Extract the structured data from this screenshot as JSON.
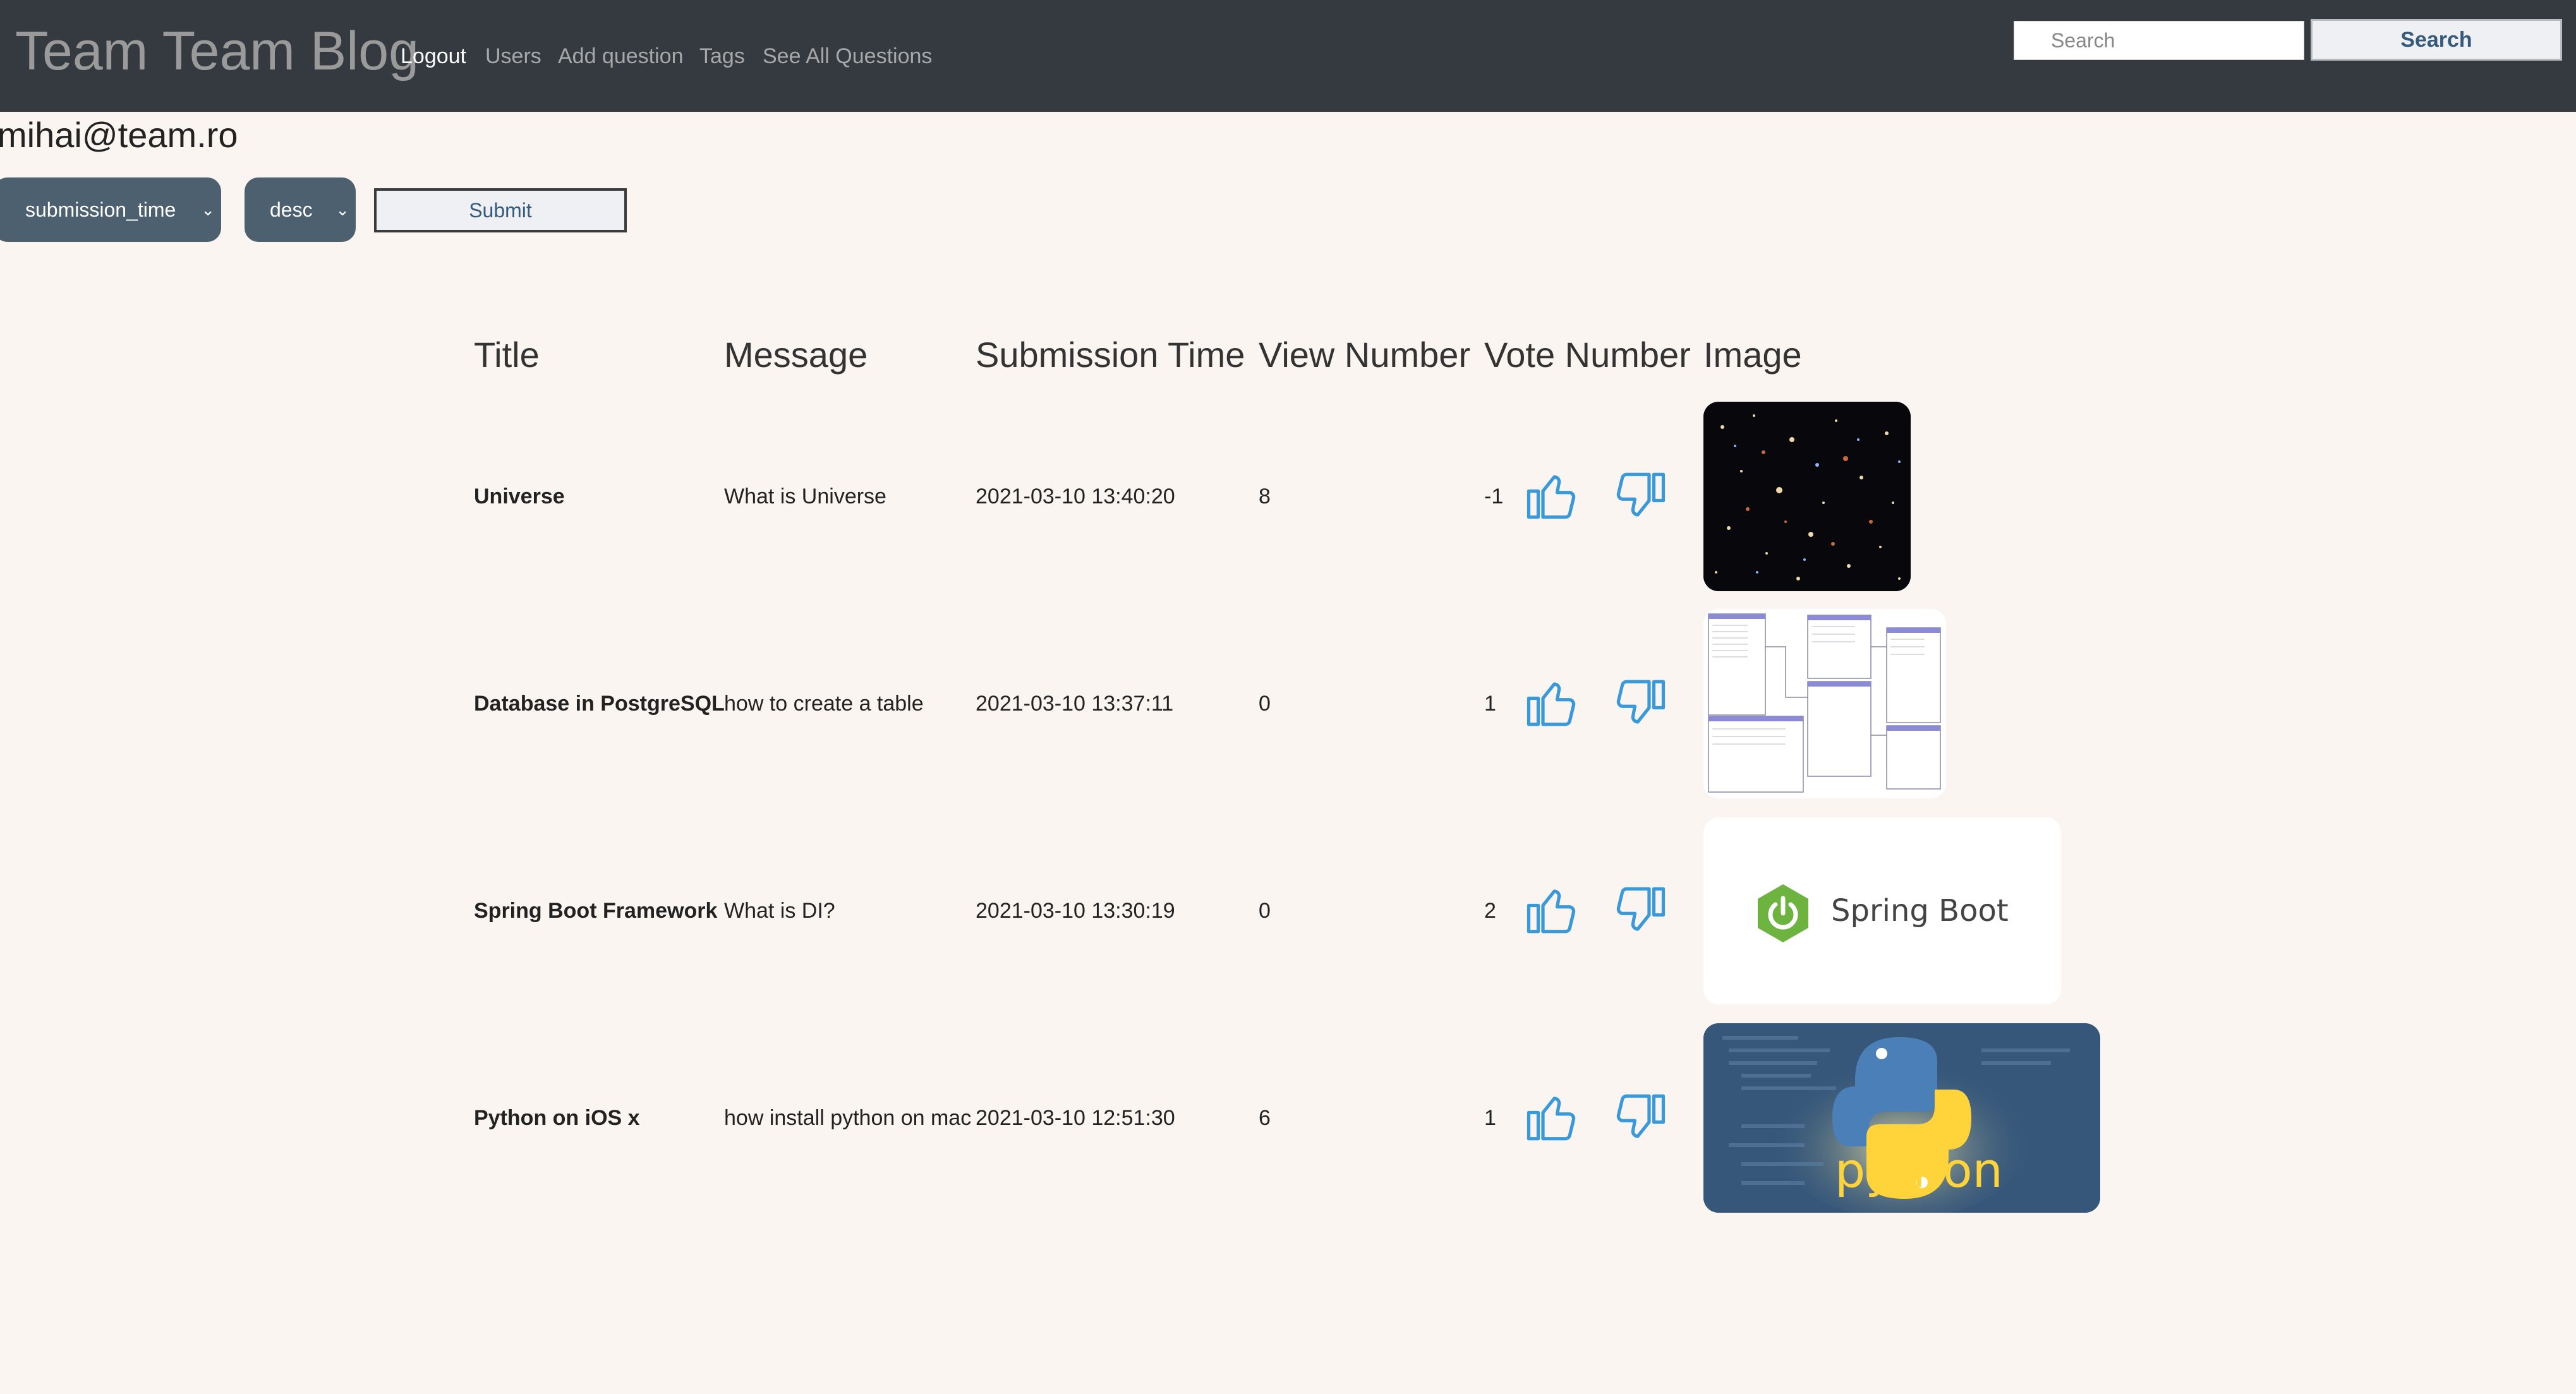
{
  "navbar": {
    "brand": "Team Team Blog",
    "links": [
      "Logout",
      "Users",
      "Add question",
      "Tags",
      "See All Questions"
    ],
    "search_placeholder": "Search",
    "search_button": "Search"
  },
  "user": {
    "email": "mihai@team.ro"
  },
  "sort_controls": {
    "sort_by": "submission_time",
    "order": "desc",
    "submit": "Submit"
  },
  "table": {
    "headers": [
      "Title",
      "Message",
      "Submission Time",
      "View Number",
      "Vote Number",
      "Image"
    ],
    "rows": [
      {
        "title": "Universe",
        "message": "What is Universe",
        "submission_time": "2021-03-10 13:40:20",
        "views": "8",
        "votes": "-1",
        "image": "galaxy-field-image"
      },
      {
        "title": "Database in PostgreSQL",
        "message": "how to create a table",
        "submission_time": "2021-03-10 13:37:11",
        "views": "0",
        "votes": "1",
        "image": "database-schema-image"
      },
      {
        "title": "Spring Boot Framework",
        "message": "What is DI?",
        "submission_time": "2021-03-10 13:30:19",
        "views": "0",
        "votes": "2",
        "image": "spring-boot-logo-image"
      },
      {
        "title": "Python on iOS x",
        "message": "how install python on mac",
        "submission_time": "2021-03-10 12:51:30",
        "views": "6",
        "votes": "1",
        "image": "python-logo-image"
      }
    ]
  },
  "images": {
    "spring_boot_text": "Spring Boot",
    "python_text": "python"
  },
  "colors": {
    "navbar": "#343a40",
    "page_background": "#fbf5f1",
    "thumb_icon": "#3a9ad9",
    "select_background": "#4d6070"
  },
  "icons": {
    "vote_up": "thumbs-up-icon",
    "vote_down": "thumbs-down-icon",
    "select_chevron": "chevron-down-icon"
  }
}
